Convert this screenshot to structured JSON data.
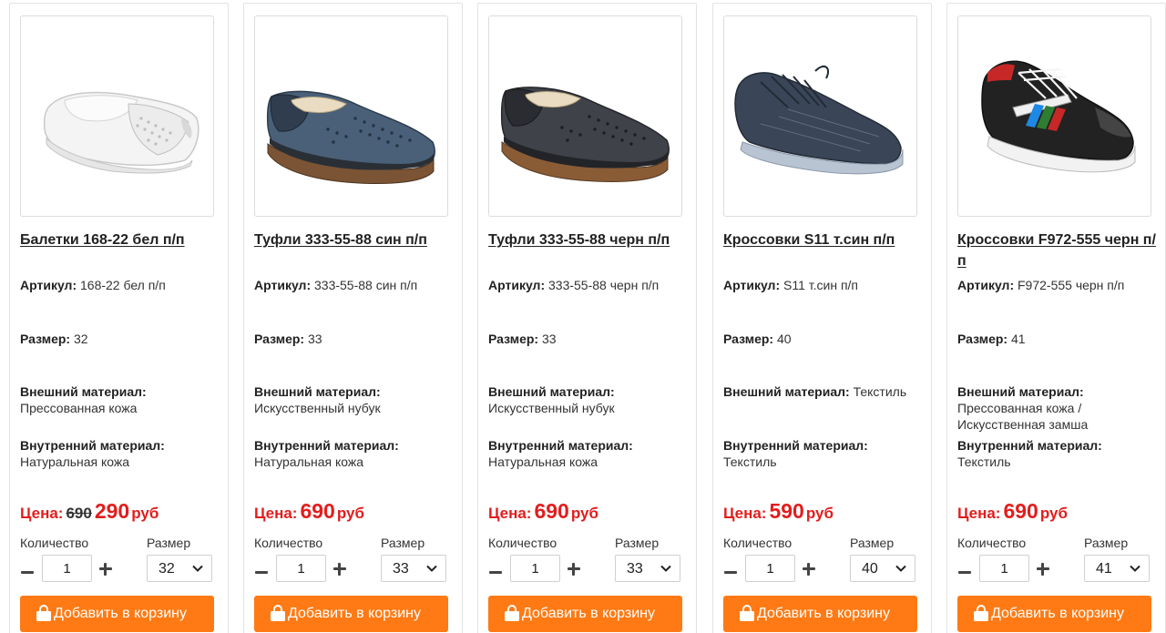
{
  "labels": {
    "article": "Артикул:",
    "size": "Размер:",
    "outer_material": "Внешний материал:",
    "inner_material": "Внутренний материал:",
    "price": "Цена:",
    "currency": "руб",
    "quantity": "Количество",
    "size_select": "Размер",
    "add_to_cart": "Добавить в корзину"
  },
  "colors": {
    "price_red": "#e21d1d",
    "cart_orange": "#ff7a14"
  },
  "products": [
    {
      "title": "Балетки 168-22 бел п/п",
      "article": "168-22 бел п/п",
      "size": "32",
      "outer": "Прессованная кожа",
      "inner": "Натуральная кожа",
      "old_price": "690",
      "price": "290",
      "qty": "1",
      "size_value": "32",
      "image": "white-ballet-flat"
    },
    {
      "title": "Туфли 333-55-88 син п/п",
      "article": "333-55-88 син п/п",
      "size": "33",
      "outer": "Искусственный нубук",
      "inner": "Натуральная кожа",
      "old_price": "",
      "price": "690",
      "qty": "1",
      "size_value": "33",
      "image": "blue-perforated-loafer"
    },
    {
      "title": "Туфли 333-55-88 черн п/п",
      "article": "333-55-88 черн п/п",
      "size": "33",
      "outer": "Искусственный нубук",
      "inner": "Натуральная кожа",
      "old_price": "",
      "price": "690",
      "qty": "1",
      "size_value": "33",
      "image": "black-perforated-loafer"
    },
    {
      "title": "Кроссовки S11 т.син п/п",
      "article": "S11 т.син п/п",
      "size": "40",
      "outer": "Текстиль",
      "inner": "Текстиль",
      "old_price": "",
      "price": "590",
      "qty": "1",
      "size_value": "40",
      "image": "navy-knit-sneaker"
    },
    {
      "title": "Кроссовки F972-555 черн п/п",
      "article": "F972-555 черн п/п",
      "size": "41",
      "outer": "Прессованная кожа / Искусственная замша",
      "inner": "Текстиль",
      "old_price": "",
      "price": "690",
      "qty": "1",
      "size_value": "41",
      "image": "black-color-sneaker"
    }
  ]
}
